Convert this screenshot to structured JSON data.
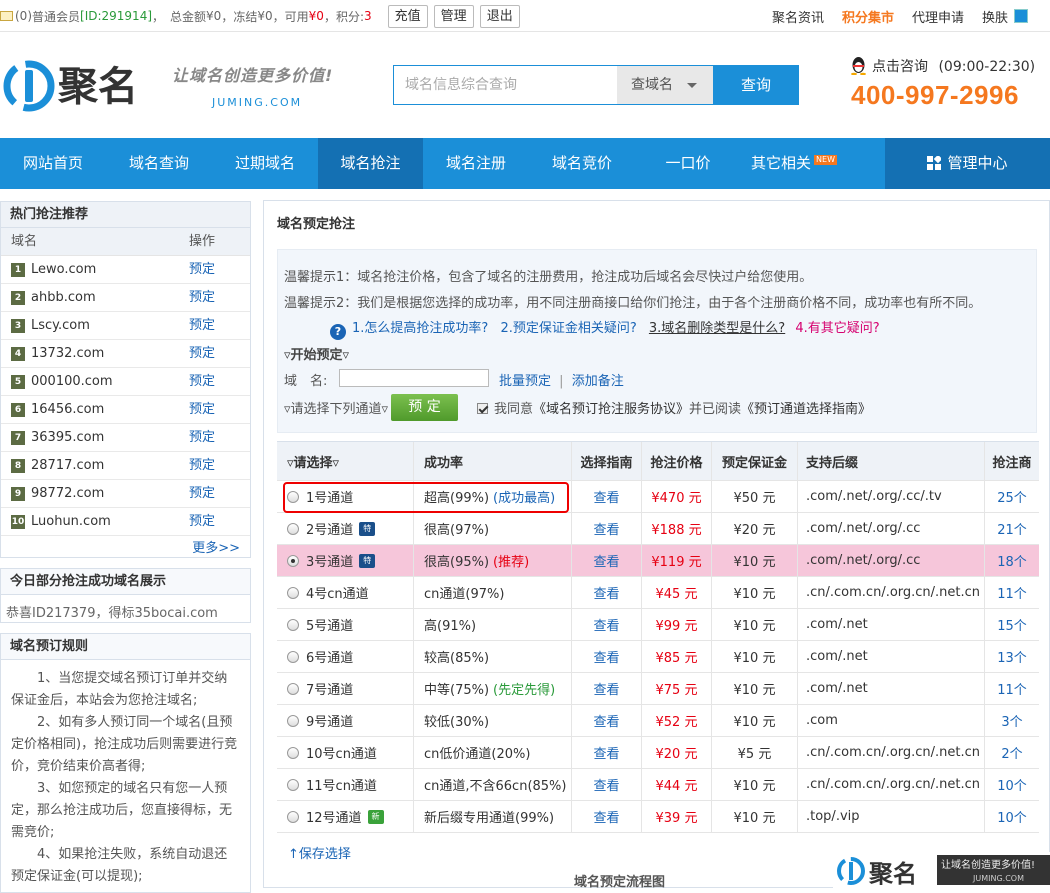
{
  "topbar": {
    "msg_count": "(0)",
    "user_type": "普通会员",
    "user_id": "[ID:291914]",
    "total_label": "总金额",
    "total_value": "¥0",
    "frozen_label": "冻结",
    "frozen_value": "¥0",
    "avail_label": "可用",
    "avail_value": "¥0",
    "points_label": "积分:",
    "points_value": "3",
    "buttons": [
      "充值",
      "管理",
      "退出"
    ],
    "right_links": [
      "聚名资讯",
      "积分集市",
      "代理申请",
      "换肤"
    ]
  },
  "header": {
    "logo_text": "聚名",
    "slogan": "让域名创造更多价值!",
    "slogan_sub": "JUMING.COM",
    "search_placeholder": "域名信息综合查询",
    "search_select": "查域名",
    "search_button": "查询",
    "contact": "点击咨询",
    "hours": "(09:00-22:30)",
    "phone": "400-997-2996"
  },
  "nav": {
    "items": [
      "网站首页",
      "域名查询",
      "过期域名",
      "域名抢注",
      "域名注册",
      "域名竞价",
      "一口价",
      "其它相关"
    ],
    "new_badge": "NEW",
    "manager": "管理中心"
  },
  "hot": {
    "title": "热门抢注推荐",
    "col_domain": "域名",
    "col_op": "操作",
    "rows": [
      {
        "n": "1",
        "domain": "Lewo.com",
        "op": "预定"
      },
      {
        "n": "2",
        "domain": "ahbb.com",
        "op": "预定"
      },
      {
        "n": "3",
        "domain": "Lscy.com",
        "op": "预定"
      },
      {
        "n": "4",
        "domain": "13732.com",
        "op": "预定"
      },
      {
        "n": "5",
        "domain": "000100.com",
        "op": "预定"
      },
      {
        "n": "6",
        "domain": "16456.com",
        "op": "预定"
      },
      {
        "n": "7",
        "domain": "36395.com",
        "op": "预定"
      },
      {
        "n": "8",
        "domain": "28717.com",
        "op": "预定"
      },
      {
        "n": "9",
        "domain": "98772.com",
        "op": "预定"
      },
      {
        "n": "10",
        "domain": "Luohun.com",
        "op": "预定"
      }
    ],
    "more": "更多>>"
  },
  "today": {
    "title": "今日部分抢注成功域名展示",
    "scroll_text": "恭喜ID217379，得标35bocai.com"
  },
  "rules": {
    "title": "域名预订规则",
    "items": [
      "1、当您提交域名预订订单并交纳保证金后，本站会为您抢注域名;",
      "2、如有多人预订同一个域名(且预定价格相同)，抢注成功后则需要进行竞价，竞价结束价高者得;",
      "3、如您预定的域名只有您一人预定，那么抢注成功后，您直接得标，无需竞价;",
      "4、如果抢注失败，系统自动退还预定保证金(可以提现);"
    ]
  },
  "main": {
    "title": "域名预定抢注",
    "tip1": "温馨提示1：域名抢注价格，包含了域名的注册费用，抢注成功后域名会尽快过户给您使用。",
    "tip2": "温馨提示2：我们是根据您选择的成功率，用不同注册商接口给你们抢注，由于各个注册商价格不同，成功率也有所不同。",
    "faq": [
      "1.怎么提高抢注成功率?",
      "2.预定保证金相关疑问?",
      "3.域名删除类型是什么?",
      "4.有其它疑问?"
    ],
    "start_label": "▿开始预定▿",
    "domain_label": "域　名:",
    "batch": "批量预定",
    "sep": "|",
    "add_note": "添加备注",
    "channel_label": "▿请选择下列通道▿",
    "submit": "预 定",
    "agree_pre": "我同意",
    "agree_link1": "《域名预订抢注服务协议》",
    "agree_mid": "并已阅读",
    "agree_link2": "《预订通道选择指南》",
    "save": "↑保存选择",
    "flow_title": "域名预定流程图"
  },
  "table": {
    "headers": [
      "▿请选择▿",
      "成功率",
      "选择指南",
      "抢注价格",
      "预定保证金",
      "支持后缀",
      "抢注商"
    ],
    "rows": [
      {
        "channel": "1号通道",
        "rate": "超高(99%)",
        "note": "(成功最高)",
        "note_color": "blue",
        "guide": "查看",
        "price": "¥470 元",
        "deposit": "¥50 元",
        "suffix": ".com/.net/.org/.cc/.tv",
        "count": "25个",
        "tag": ""
      },
      {
        "channel": "2号通道",
        "rate": "很高(97%)",
        "note": "",
        "note_color": "",
        "guide": "查看",
        "price": "¥188 元",
        "deposit": "¥20 元",
        "suffix": ".com/.net/.org/.cc",
        "count": "21个",
        "tag": "blue"
      },
      {
        "channel": "3号通道",
        "rate": "很高(95%)",
        "note": "(推荐)",
        "note_color": "red",
        "guide": "查看",
        "price": "¥119 元",
        "deposit": "¥10 元",
        "suffix": ".com/.net/.org/.cc",
        "count": "18个",
        "tag": "blue"
      },
      {
        "channel": "4号cn通道",
        "rate": "cn通道(97%)",
        "note": "",
        "note_color": "",
        "guide": "查看",
        "price": "¥45 元",
        "deposit": "¥10 元",
        "suffix": ".cn/.com.cn/.org.cn/.net.cn",
        "count": "11个",
        "tag": ""
      },
      {
        "channel": "5号通道",
        "rate": "高(91%)",
        "note": "",
        "note_color": "",
        "guide": "查看",
        "price": "¥99 元",
        "deposit": "¥10 元",
        "suffix": ".com/.net",
        "count": "15个",
        "tag": ""
      },
      {
        "channel": "6号通道",
        "rate": "较高(85%)",
        "note": "",
        "note_color": "",
        "guide": "查看",
        "price": "¥85 元",
        "deposit": "¥10 元",
        "suffix": ".com/.net",
        "count": "13个",
        "tag": ""
      },
      {
        "channel": "7号通道",
        "rate": "中等(75%)",
        "note": "(先定先得)",
        "note_color": "green",
        "guide": "查看",
        "price": "¥75 元",
        "deposit": "¥10 元",
        "suffix": ".com/.net",
        "count": "11个",
        "tag": ""
      },
      {
        "channel": "9号通道",
        "rate": "较低(30%)",
        "note": "",
        "note_color": "",
        "guide": "查看",
        "price": "¥52 元",
        "deposit": "¥10 元",
        "suffix": ".com",
        "count": "3个",
        "tag": ""
      },
      {
        "channel": "10号cn通道",
        "rate": "cn低价通道(20%)",
        "note": "",
        "note_color": "",
        "guide": "查看",
        "price": "¥20 元",
        "deposit": "¥5 元",
        "suffix": ".cn/.com.cn/.org.cn/.net.cn",
        "count": "2个",
        "tag": ""
      },
      {
        "channel": "11号cn通道",
        "rate": "cn通道,不含66cn(85%)",
        "note": "",
        "note_color": "",
        "guide": "查看",
        "price": "¥44 元",
        "deposit": "¥10 元",
        "suffix": ".cn/.com.cn/.org.cn/.net.cn",
        "count": "10个",
        "tag": ""
      },
      {
        "channel": "12号通道",
        "rate": "新后缀专用通道(99%)",
        "note": "",
        "note_color": "",
        "guide": "查看",
        "price": "¥39 元",
        "deposit": "¥10 元",
        "suffix": ".top/.vip",
        "count": "10个",
        "tag": "green"
      }
    ],
    "selected_index": 2,
    "highlight_index": 2,
    "tag_text": {
      "blue": "特",
      "green": "新"
    }
  },
  "watermark": {
    "logo": "聚名",
    "slogan": "让域名创造更多价值!",
    "sub": "JUMING.COM"
  },
  "colors": {
    "brand_blue": "#1b8fd8",
    "nav_active": "#1470b3",
    "phone_orange": "#f5781f",
    "highlight_row": "#f6c6da",
    "price_red": "#e60012"
  }
}
